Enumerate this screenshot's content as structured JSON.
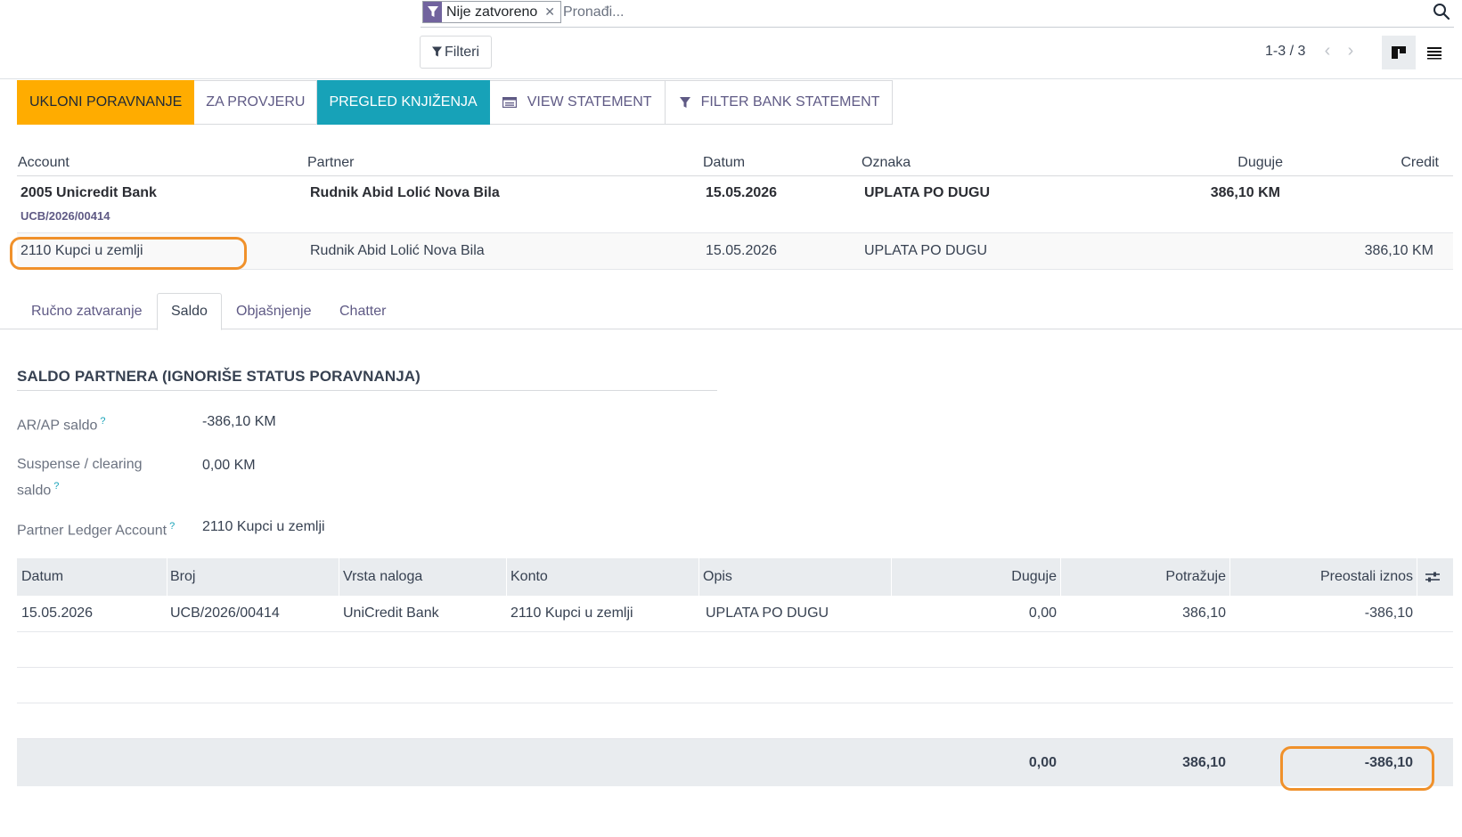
{
  "search": {
    "facet_label": "Nije zatvoreno",
    "placeholder": "Pronađi...",
    "filter_icon": "filter-icon",
    "search_icon": "magnifier-icon"
  },
  "control_panel": {
    "filters_label": "Filteri",
    "pager_value": "1-3 / 3",
    "views": [
      "kanban-view-icon",
      "list-view-icon"
    ],
    "active_view": "kanban"
  },
  "actions": {
    "remove_reconcile": "UKLONI PORAVNANJE",
    "to_check": "ZA PROVJERU",
    "review_entries": "PREGLED KNJIŽENJA",
    "view_statement": "VIEW STATEMENT",
    "filter_statement": "FILTER BANK STATEMENT"
  },
  "lines": {
    "headers": {
      "account": "Account",
      "partner": "Partner",
      "date": "Datum",
      "label": "Oznaka",
      "debit": "Duguje",
      "credit": "Credit"
    },
    "rows": [
      {
        "account": "2005 Unicredit Bank",
        "ref": "UCB/2026/00414",
        "partner": "Rudnik Abid Lolić Nova Bila",
        "date": "15.05.2026",
        "label": "UPLATA PO DUGU",
        "debit": "386,10 KM",
        "credit": ""
      },
      {
        "account": "2110 Kupci u zemlji",
        "partner": "Rudnik Abid Lolić Nova Bila",
        "date": "15.05.2026",
        "label": "UPLATA PO DUGU",
        "debit": "",
        "credit": "386,10 KM"
      }
    ]
  },
  "tabs": [
    "Ručno zatvaranje",
    "Saldo",
    "Objašnjenje",
    "Chatter"
  ],
  "active_tab": "Saldo",
  "saldo": {
    "title": "SALDO PARTNERA (IGNORIŠE STATUS PORAVNANJA)",
    "arap_label": "AR/AP saldo",
    "arap_value": "-386,10 KM",
    "suspense_label_1": "Suspense / clearing",
    "suspense_label_2": "saldo",
    "suspense_value": "0,00 KM",
    "ledger_label": "Partner Ledger Account",
    "ledger_value": "2110 Kupci u zemlji",
    "help_mark": "?"
  },
  "ledger_table": {
    "headers": {
      "date": "Datum",
      "number": "Broj",
      "journal": "Vrsta naloga",
      "account": "Konto",
      "description": "Opis",
      "debit": "Duguje",
      "credit": "Potražuje",
      "residual": "Preostali iznos"
    },
    "rows": [
      {
        "date": "15.05.2026",
        "number": "UCB/2026/00414",
        "journal": "UniCredit Bank",
        "account": "2110 Kupci u zemlji",
        "description": "UPLATA PO DUGU",
        "debit": "0,00",
        "credit": "386,10",
        "residual": "-386,10"
      }
    ],
    "totals": {
      "debit": "0,00",
      "credit": "386,10",
      "residual": "-386,10"
    },
    "settings_icon": "column-settings-icon"
  },
  "colors": {
    "warning": "#ffac00",
    "teal": "#17a2b8",
    "primary": "#71639e",
    "highlight": "#f0912b"
  }
}
